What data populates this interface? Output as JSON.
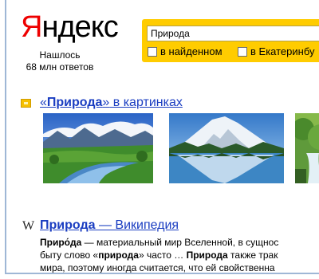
{
  "logo": {
    "first_letter": "Я",
    "rest": "ндекс"
  },
  "results_info": {
    "line1": "Нашлось",
    "line2": "68 млн ответов"
  },
  "search": {
    "query": "Природа",
    "filter_in_found": "в найденном",
    "filter_region": "в Екатеринбу"
  },
  "images_block": {
    "icon": "images-icon",
    "title_quote_open": "«",
    "title_query": "Природа",
    "title_quote_close": "»",
    "title_rest": " в картинках",
    "thumbnails": [
      "mountain-meadow-river",
      "snow-mountain-lake-reflection",
      "forest-waterfall"
    ]
  },
  "wiki_result": {
    "icon": "wikipedia-icon",
    "icon_glyph": "W",
    "title_query": "Природа",
    "title_rest": " — Википедия",
    "snippet_line1_bold": "Приро́да",
    "snippet_line1_rest": " — материальный мир Вселенной, в сущнос",
    "snippet_line2_a": "быту слово «",
    "snippet_line2_bold1": "природа",
    "snippet_line2_b": "» часто … ",
    "snippet_line2_bold2": "Природа",
    "snippet_line2_c": " также трак",
    "snippet_line3": "мира, поэтому иногда считается, что ей свойственна"
  },
  "colors": {
    "logo_red": "#ee0000",
    "search_yellow": "#ffcc00",
    "link_blue": "#1a3dc1"
  }
}
